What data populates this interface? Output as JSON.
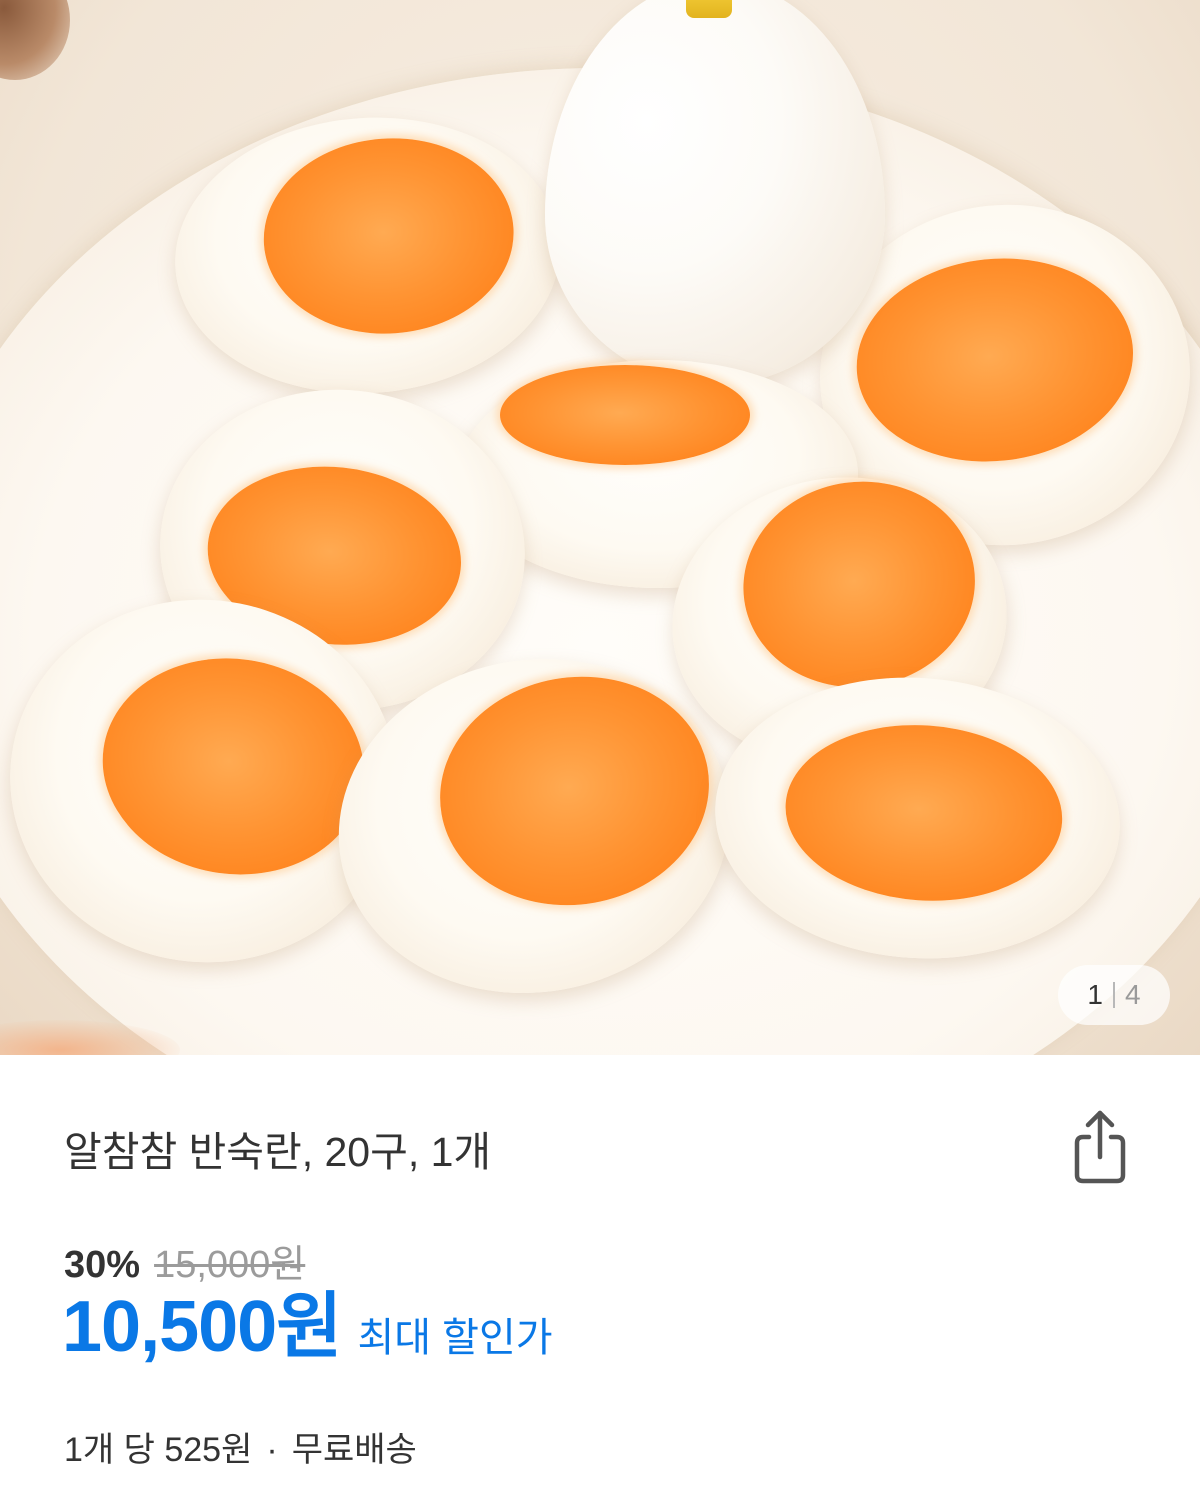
{
  "gallery": {
    "current": "1",
    "total": "4"
  },
  "product": {
    "title": "알참참 반숙란, 20구, 1개"
  },
  "pricing": {
    "discount_rate": "30%",
    "original_price": "15,000원",
    "sale_price": "10,500원",
    "sale_price_label": "최대 할인가",
    "unit_price": "1개 당 525원",
    "separator": "·",
    "shipping": "무료배송"
  },
  "icons": {
    "share": "share-icon"
  },
  "colors": {
    "price_accent": "#0a78e6",
    "text_primary": "#333333",
    "text_muted": "#9b9b9b",
    "yolk": "#ff9433"
  }
}
